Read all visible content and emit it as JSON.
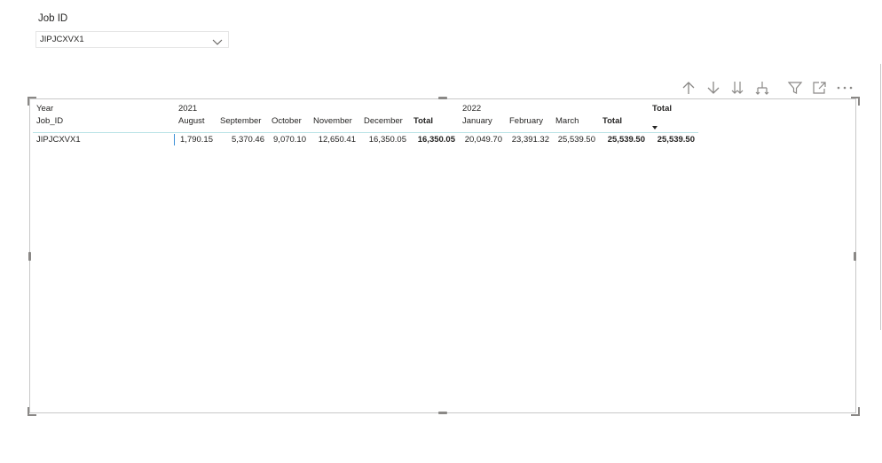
{
  "slicer": {
    "title": "Job ID",
    "selected_value": "JIPJCXVX1"
  },
  "visual_header": {
    "icons": [
      "drill-up-icon",
      "drill-down-icon",
      "expand-next-level-icon",
      "expand-hierarchy-icon",
      "filter-icon",
      "focus-mode-icon",
      "more-options-icon"
    ]
  },
  "matrix": {
    "row_header_labels": {
      "year": "Year",
      "job_id": "Job_ID"
    },
    "year_2021": "2021",
    "year_2022": "2022",
    "grand_total_label": "Total",
    "columns": {
      "august": "August",
      "september": "September",
      "october": "October",
      "november": "November",
      "december": "December",
      "total_2021": "Total",
      "january": "January",
      "february": "February",
      "march": "March",
      "total_2022": "Total"
    },
    "row": {
      "job_id": "JIPJCXVX1",
      "august": "1,790.15",
      "september": "5,370.46",
      "october": "9,070.10",
      "november": "12,650.41",
      "december": "16,350.05",
      "total_2021": "16,350.05",
      "january": "20,049.70",
      "february": "23,391.32",
      "march": "25,539.50",
      "total_2022": "25,539.50",
      "grand_total": "25,539.50"
    }
  },
  "colors": {
    "header_rule": "#b9e3e6",
    "selection_bar": "#3b8fd6",
    "frame_border": "#c8c8c8",
    "icon": "#8a8886"
  }
}
